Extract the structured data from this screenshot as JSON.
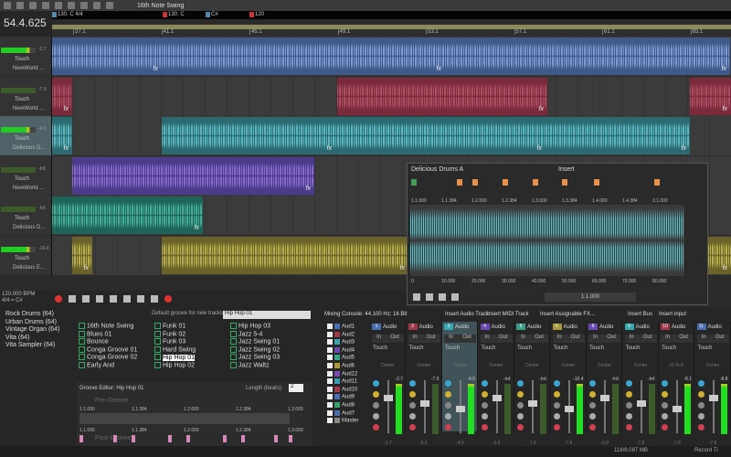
{
  "toolbar": {
    "groove_selector": "16th Note Swing"
  },
  "time_display": "54.4.625",
  "markers": [
    {
      "label": "130: C 4/4",
      "blue": true
    },
    {
      "label": "130: C"
    },
    {
      "label": "C#",
      "blue": true
    },
    {
      "label": "120"
    }
  ],
  "ruler": [
    "37.1",
    "41.1",
    "45.1",
    "49.1",
    "53.1",
    "57.1",
    "61.1",
    "65.1"
  ],
  "tracks": [
    {
      "name": "NewWorld ...",
      "peak": "-2.7",
      "automation": "Touch",
      "color": "#3f5a8a",
      "wave": "#8fb0e8",
      "active": true
    },
    {
      "name": "NewWorld ...",
      "peak": "-7.5",
      "automation": "Touch",
      "color": "#7a2a3a",
      "wave": "#c05a70",
      "active": false
    },
    {
      "name": "Delicious D...",
      "peak": "-4.5",
      "automation": "Touch",
      "color": "#2a6a70",
      "wave": "#6fd4dc",
      "active": true
    },
    {
      "name": "NewWorld ...",
      "peak": "-Inf.",
      "automation": "Touch",
      "color": "#4c3a8a",
      "wave": "#9a7ae0",
      "active": false
    },
    {
      "name": "Delicious D...",
      "peak": "-Inf.",
      "automation": "Touch",
      "color": "#1f6458",
      "wave": "#52c8b0",
      "active": false
    },
    {
      "name": "Delicious E...",
      "peak": "-10.4",
      "automation": "Touch",
      "color": "#6a6228",
      "wave": "#d2c85a",
      "active": true
    }
  ],
  "transport": {
    "tempo": "120.000 BPM",
    "time_sig": "4/4",
    "key": "= C#"
  },
  "clip_editor": {
    "title": "Delicious Drums A",
    "insert_label": "Insert",
    "top_ticks": [
      "1.1.000",
      "1.1.384",
      "1.2.000",
      "1.2.384",
      "1.3.000",
      "1.3.384",
      "1.4.000",
      "1.4.384",
      "2.1.000"
    ],
    "bottom_ticks": [
      "0",
      "10.000",
      "20.000",
      "30.000",
      "40.000",
      "50.000",
      "60.000",
      "70.000",
      "80.000"
    ],
    "position": "1.1.000"
  },
  "instruments": [
    "Rock Drums (64)",
    "Urban Drums (64)",
    "Vintage Organ (64)",
    "Vita (64)",
    "Vita Sampler (64)"
  ],
  "groove_pool": {
    "default_label": "Default groove for new tracks:",
    "default_value": "Hip Hop 01",
    "selected": "Hip Hop 01",
    "items": [
      "16th Note Swing",
      "Blues 01",
      "Bounce",
      "Conga Groove 01",
      "Conga Groove 02",
      "Early And",
      "Funk 01",
      "Funk 02",
      "Funk 03",
      "Hard Swing",
      "Hip Hop 01",
      "Hip Hop 02",
      "Hip Hop 03",
      "Jazz 5-4",
      "Jazz Swing 01",
      "Jazz Swing 02",
      "Jazz Swing 03",
      "Jazz Waltz"
    ]
  },
  "groove_editor": {
    "title": "Groove Editor:",
    "name": "Hip Hop 01",
    "length_label": "Length (beats):",
    "length": "2",
    "pre_label": "Pre-Groove",
    "post_label": "Post-Groove",
    "ticks": [
      "1.1.000",
      "1.1.384",
      "1.2.000",
      "1.2.384",
      "1.3.000"
    ]
  },
  "mixer": {
    "title": "Mixing Console: 44.100 Hz; 16 Bit",
    "buttons": [
      "Insert Audio Track",
      "Insert MIDI Track",
      "Insert Assignable FX...",
      "Insert Bus",
      "Insert Input"
    ],
    "list": [
      {
        "n": "1",
        "name": "Aud1",
        "c": "#4a6fb0"
      },
      {
        "n": "2",
        "name": "Aud2",
        "c": "#a03a4a"
      },
      {
        "n": "3",
        "name": "Aud3",
        "c": "#3aa6b0"
      },
      {
        "n": "4",
        "name": "Aud4",
        "c": "#6a4ab0"
      },
      {
        "n": "5",
        "name": "Aud5",
        "c": "#3aa08a"
      },
      {
        "n": "6",
        "name": "Aud6",
        "c": "#a89a3a"
      },
      {
        "n": "12",
        "name": "Aud12",
        "c": "#7a4ab0"
      },
      {
        "n": "11",
        "name": "Aud11",
        "c": "#3a9ab0"
      },
      {
        "n": "10",
        "name": "Aud10",
        "c": "#a03a4a"
      },
      {
        "n": "9",
        "name": "Aud9",
        "c": "#4a6fb0"
      },
      {
        "n": "8",
        "name": "Aud8",
        "c": "#3aa06a"
      },
      {
        "n": "7",
        "name": "Aud7",
        "c": "#4a6fb0"
      },
      {
        "n": "",
        "name": "Master",
        "c": "#888"
      }
    ],
    "in_label": "In",
    "out_label": "Out",
    "strips": [
      {
        "n": "1",
        "name": "Audio",
        "c": "#4a6fb0",
        "pan": "Center",
        "peak": "-2.7",
        "vol": "-1.7",
        "on": true
      },
      {
        "n": "2",
        "name": "Audio",
        "c": "#a03a4a",
        "pan": "Center",
        "peak": "-7.5",
        "vol": "0.2",
        "on": false
      },
      {
        "n": "3",
        "name": "Audio",
        "c": "#3aa6b0",
        "pan": "Center",
        "peak": "-4.5",
        "vol": "-4.5",
        "on": true
      },
      {
        "n": "4",
        "name": "Audio",
        "c": "#6a4ab0",
        "pan": "Center",
        "peak": "-Inf.",
        "vol": "-3.9",
        "on": false
      },
      {
        "n": "5",
        "name": "Audio",
        "c": "#3aa08a",
        "pan": "Center",
        "peak": "-Inf.",
        "vol": "-7.8",
        "on": false
      },
      {
        "n": "6",
        "name": "Audio",
        "c": "#a89a3a",
        "pan": "Center",
        "peak": "-10.4",
        "vol": "-7.8",
        "on": true
      },
      {
        "n": "8",
        "name": "Audio",
        "c": "#6a4ab0",
        "pan": "Center",
        "peak": "-Inf.",
        "vol": "-3.9",
        "on": false
      },
      {
        "n": "9",
        "name": "Audio",
        "c": "#3aa6b0",
        "pan": "Center",
        "peak": "-Inf.",
        "vol": "-7.8",
        "on": false
      },
      {
        "n": "10",
        "name": "Audio",
        "c": "#a03a4a",
        "pan": "11 % R",
        "peak": "-8.1",
        "vol": "-7.8",
        "on": true
      },
      {
        "n": "11",
        "name": "Audio",
        "c": "#4a6fb0",
        "pan": "Center",
        "peak": "-8.8",
        "vol": "-7.8",
        "on": true
      }
    ]
  },
  "status": {
    "memory": "118/8,087 MB",
    "record": "Record Ti"
  }
}
